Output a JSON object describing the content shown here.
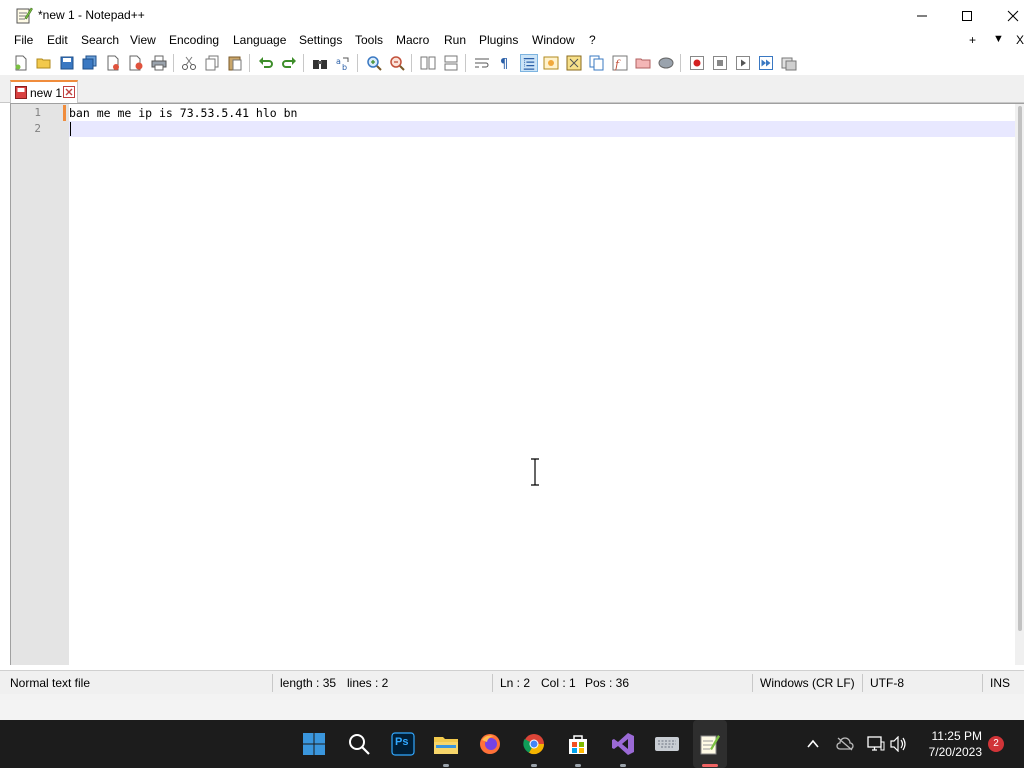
{
  "window": {
    "title": "*new 1 - Notepad++"
  },
  "menu": {
    "items": [
      "File",
      "Edit",
      "Search",
      "View",
      "Encoding",
      "Language",
      "Settings",
      "Tools",
      "Macro",
      "Run",
      "Plugins",
      "Window",
      "?"
    ],
    "right_plus": "+",
    "right_down": "▼",
    "right_close": "X"
  },
  "tab": {
    "label": "new 1"
  },
  "editor": {
    "line_numbers": [
      "1",
      "2"
    ],
    "lines": [
      "ban me me ip is 73.53.5.41 hlo bn",
      ""
    ]
  },
  "status": {
    "file_type": "Normal text file",
    "length": "length : 35",
    "lines": "lines : 2",
    "ln": "Ln : 2",
    "col": "Col : 1",
    "pos": "Pos : 36",
    "eol": "Windows (CR LF)",
    "encoding": "UTF-8",
    "mode": "INS"
  },
  "taskbar": {
    "time": "11:25 PM",
    "date": "7/20/2023",
    "notification_count": "2",
    "ps_label": "Ps"
  },
  "colors": {
    "accent_orange": "#f08c3c",
    "taskbar_bg": "#1c1c1c",
    "current_line": "#e8e8ff",
    "badge_red": "#d13438",
    "windows_blue": "#3a96dd"
  }
}
